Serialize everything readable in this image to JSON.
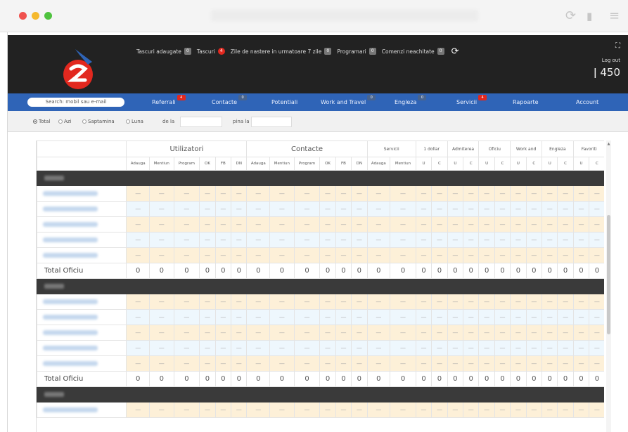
{
  "notifications": [
    {
      "label": "Tascuri adaugate",
      "badge": "0",
      "red": false
    },
    {
      "label": "Tascuri",
      "badge": "4",
      "red": true
    },
    {
      "label": "Zile de nastere in urmatoare 7 zile",
      "badge": "0",
      "red": false
    },
    {
      "label": "Programari",
      "badge": "0",
      "red": false
    },
    {
      "label": "Comenzi neachitate",
      "badge": "0",
      "red": false
    }
  ],
  "user": {
    "logout": "Log out",
    "count": "450"
  },
  "search": {
    "placeholder": "Search: mobil sau e-mail"
  },
  "nav": [
    {
      "label": "Referrali",
      "badge": "4",
      "red": true
    },
    {
      "label": "Contacte",
      "badge": "0",
      "red": false
    },
    {
      "label": "Potentiali",
      "badge": "",
      "red": false
    },
    {
      "label": "Work and Travel",
      "badge": "0",
      "red": false
    },
    {
      "label": "Engleza",
      "badge": "0",
      "red": false
    },
    {
      "label": "Servicii",
      "badge": "4",
      "red": true
    },
    {
      "label": "Rapoarte",
      "badge": "",
      "red": false
    },
    {
      "label": "Account",
      "badge": "",
      "red": false
    }
  ],
  "filters": {
    "radios": [
      {
        "label": "Total",
        "checked": true
      },
      {
        "label": "Azi",
        "checked": false
      },
      {
        "label": "Saptamina",
        "checked": false
      },
      {
        "label": "Luna",
        "checked": false
      }
    ],
    "from_label": "de la",
    "to_label": "pina la"
  },
  "table": {
    "group_headers": [
      {
        "label": "Utilizatori",
        "span": 6,
        "small": false
      },
      {
        "label": "Contacte",
        "span": 6,
        "small": false
      },
      {
        "label": "Servicii",
        "span": 2,
        "small": true
      },
      {
        "label": "1 dollar",
        "span": 2,
        "small": true
      },
      {
        "label": "Admiterea",
        "span": 2,
        "small": true
      },
      {
        "label": "Oficiu",
        "span": 2,
        "small": true
      },
      {
        "label": "Work and",
        "span": 2,
        "small": true
      },
      {
        "label": "Engleza",
        "span": 2,
        "small": true
      },
      {
        "label": "Favoriti",
        "span": 2,
        "small": true
      }
    ],
    "sub_headers": [
      "Adauga",
      "Mentiun",
      "Program",
      "OK",
      "FB",
      "DN",
      "Adauga",
      "Mentiun",
      "Program",
      "OK",
      "FB",
      "DN",
      "Adauga",
      "Mentiun",
      "U",
      "C",
      "U",
      "C",
      "U",
      "C",
      "U",
      "C",
      "U",
      "C",
      "U",
      "C"
    ],
    "empty_cell": "—",
    "total_label": "Total Oficiu",
    "total_value": "0",
    "groups": [
      {
        "rows": 5
      },
      {
        "rows": 5
      },
      {
        "rows": 1
      }
    ]
  },
  "colors": {
    "topbar": "#222222",
    "navbar": "#2f64b7",
    "badge_red": "#e2281f",
    "row_orange": "#fdf0d8",
    "row_blue": "#eef7fd"
  }
}
